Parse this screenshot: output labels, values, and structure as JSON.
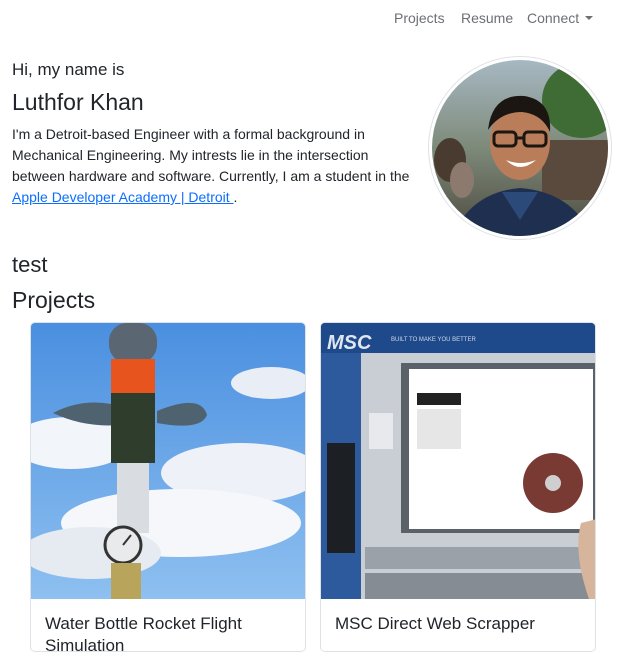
{
  "nav": {
    "items": [
      "Projects",
      "Resume",
      "Connect"
    ]
  },
  "intro": {
    "greeting": "Hi, my name is",
    "name": "Luthfor Khan",
    "bio_text": "I'm a Detroit-based Engineer with a formal background in Mechanical Engineering. My intrests lie in the intersection between hardware and software. Currently, I am a student in the ",
    "bio_link": "Apple Developer Academy | Detroit ",
    "bio_end": "."
  },
  "test_heading": "test",
  "projects": {
    "title": "Projects",
    "cards": [
      {
        "title": "Water Bottle Rocket Flight Simulation"
      },
      {
        "title": "MSC Direct Web Scrapper"
      }
    ],
    "msc_logo": "MSC",
    "msc_tagline": "BUILT TO MAKE YOU BETTER"
  },
  "colors": {
    "link": "#0d6efd",
    "nav_text": "#6c6f73",
    "sky": "#5b9be6"
  }
}
